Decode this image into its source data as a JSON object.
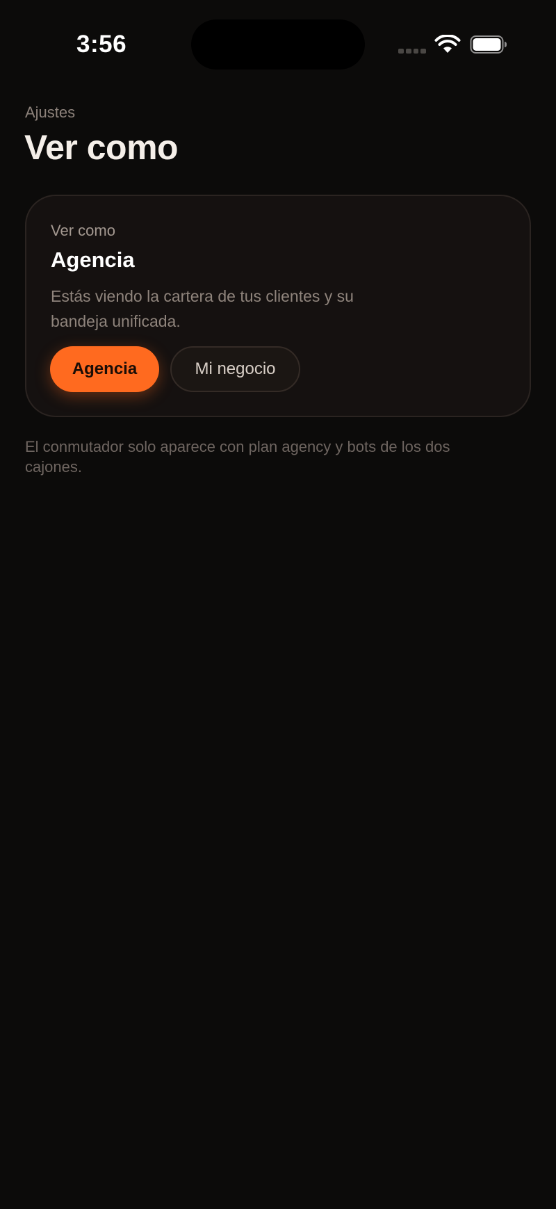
{
  "status_bar": {
    "time": "3:56"
  },
  "header": {
    "breadcrumb": "Ajustes",
    "title": "Ver como"
  },
  "card": {
    "label": "Ver como",
    "title": "Agencia",
    "description": "Estás viendo la cartera de tus clientes y su bandeja unificada.",
    "options": [
      {
        "label": "Agencia",
        "selected": true
      },
      {
        "label": "Mi negocio",
        "selected": false
      }
    ]
  },
  "footnote": "El conmutador solo aparece con plan agency y bots de los dos cajones.",
  "colors": {
    "accent": "#ff6a1f",
    "background": "#0c0b0a",
    "card_background": "#151110"
  },
  "icons": [
    "signal-icon",
    "wifi-icon",
    "battery-icon"
  ]
}
